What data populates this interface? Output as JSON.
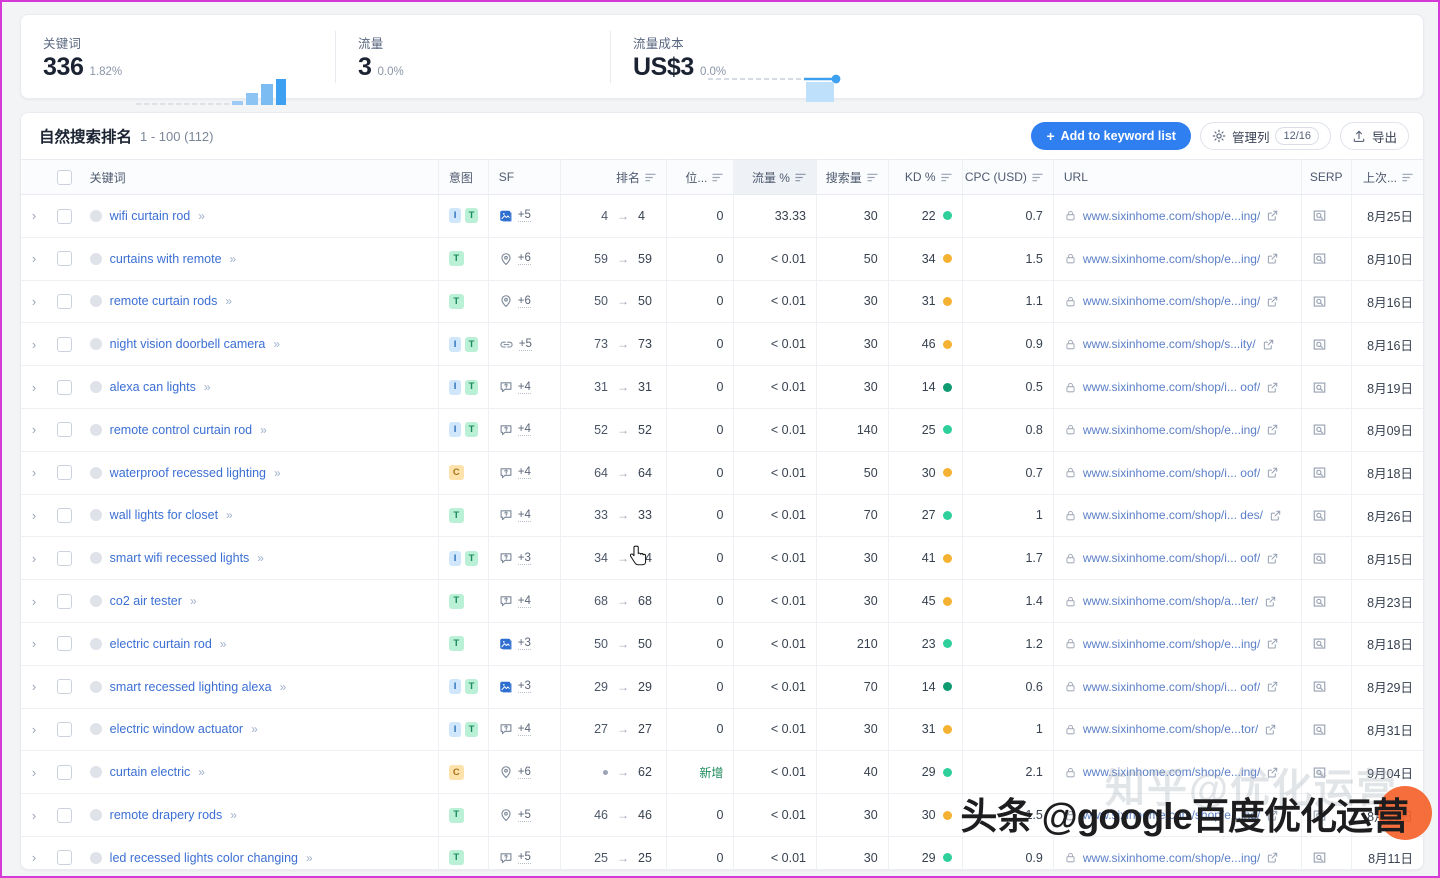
{
  "kpis": [
    {
      "title": "关键词",
      "value": "336",
      "delta": "1.82%",
      "spark": "bars"
    },
    {
      "title": "流量",
      "value": "3",
      "delta": "0.0%",
      "spark": "line-area"
    },
    {
      "title": "流量成本",
      "value": "US$3",
      "delta": "0.0%",
      "spark": "none"
    }
  ],
  "card": {
    "title": "自然搜索排名",
    "count": "1 - 100 (112)",
    "add_button": "Add to keyword list",
    "add_plus": "+",
    "manage_columns": "管理列",
    "manage_pill": "12/16",
    "export": "导出"
  },
  "columns": {
    "keyword": "关键词",
    "intent": "意图",
    "sf": "SF",
    "rank": "排名",
    "pos": "位...",
    "traffic": "流量 %",
    "volume": "搜索量",
    "kd": "KD %",
    "cpc": "CPC (USD)",
    "url": "URL",
    "serp": "SERP",
    "last": "上次..."
  },
  "colors": {
    "accent": "#2f7ff0",
    "kd_green_dark": "#0f9b72",
    "kd_green": "#2ecf9b",
    "kd_orange": "#f5b132",
    "badge_blue": "#cfe6fb",
    "badge_green": "#b9f0d6",
    "badge_orange": "#fde2ab",
    "watermark_blob": "#f4622a"
  },
  "rows": [
    {
      "keyword": "wifi curtain rod",
      "intent": [
        "I",
        "T"
      ],
      "sf_icon": "image-icon",
      "sf": "+5",
      "rank_from": "4",
      "rank_to": "4",
      "pos": "0",
      "traffic": "33.33",
      "volume": "30",
      "kd": "22",
      "kd_color": "#2ecf9b",
      "cpc": "0.7",
      "url": "www.sixinhome.com/shop/e...ing/",
      "last": "8月25日"
    },
    {
      "keyword": "curtains with remote",
      "intent": [
        "T"
      ],
      "sf_icon": "location-icon",
      "sf": "+6",
      "rank_from": "59",
      "rank_to": "59",
      "pos": "0",
      "traffic": "< 0.01",
      "volume": "50",
      "kd": "34",
      "kd_color": "#f5b132",
      "cpc": "1.5",
      "url": "www.sixinhome.com/shop/e...ing/",
      "last": "8月10日"
    },
    {
      "keyword": "remote curtain rods",
      "intent": [
        "T"
      ],
      "sf_icon": "location-icon",
      "sf": "+6",
      "rank_from": "50",
      "rank_to": "50",
      "pos": "0",
      "traffic": "< 0.01",
      "volume": "30",
      "kd": "31",
      "kd_color": "#f5b132",
      "cpc": "1.1",
      "url": "www.sixinhome.com/shop/e...ing/",
      "last": "8月16日"
    },
    {
      "keyword": "night vision doorbell camera",
      "intent": [
        "I",
        "T"
      ],
      "sf_icon": "link-icon",
      "sf": "+5",
      "rank_from": "73",
      "rank_to": "73",
      "pos": "0",
      "traffic": "< 0.01",
      "volume": "30",
      "kd": "46",
      "kd_color": "#f5b132",
      "cpc": "0.9",
      "url": "www.sixinhome.com/shop/s...ity/",
      "last": "8月16日"
    },
    {
      "keyword": "alexa can lights",
      "intent": [
        "I",
        "T"
      ],
      "sf_icon": "faq-icon",
      "sf": "+4",
      "rank_from": "31",
      "rank_to": "31",
      "pos": "0",
      "traffic": "< 0.01",
      "volume": "30",
      "kd": "14",
      "kd_color": "#0f9b72",
      "cpc": "0.5",
      "url": "www.sixinhome.com/shop/i... oof/",
      "last": "8月19日"
    },
    {
      "keyword": "remote control curtain rod",
      "intent": [
        "I",
        "T"
      ],
      "sf_icon": "faq-icon",
      "sf": "+4",
      "rank_from": "52",
      "rank_to": "52",
      "pos": "0",
      "traffic": "< 0.01",
      "volume": "140",
      "kd": "25",
      "kd_color": "#2ecf9b",
      "cpc": "0.8",
      "url": "www.sixinhome.com/shop/e...ing/",
      "last": "8月09日"
    },
    {
      "keyword": "waterproof recessed lighting",
      "intent": [
        "C"
      ],
      "sf_icon": "faq-icon",
      "sf": "+4",
      "rank_from": "64",
      "rank_to": "64",
      "pos": "0",
      "traffic": "< 0.01",
      "volume": "50",
      "kd": "30",
      "kd_color": "#f5b132",
      "cpc": "0.7",
      "url": "www.sixinhome.com/shop/i... oof/",
      "last": "8月18日"
    },
    {
      "keyword": "wall lights for closet",
      "intent": [
        "T"
      ],
      "sf_icon": "faq-icon",
      "sf": "+4",
      "rank_from": "33",
      "rank_to": "33",
      "pos": "0",
      "traffic": "< 0.01",
      "volume": "70",
      "kd": "27",
      "kd_color": "#2ecf9b",
      "cpc": "1",
      "url": "www.sixinhome.com/shop/i... des/",
      "last": "8月26日"
    },
    {
      "keyword": "smart wifi recessed lights",
      "intent": [
        "I",
        "T"
      ],
      "sf_icon": "faq-icon",
      "sf": "+3",
      "rank_from": "34",
      "rank_to": "34",
      "pos": "0",
      "traffic": "< 0.01",
      "volume": "30",
      "kd": "41",
      "kd_color": "#f5b132",
      "cpc": "1.7",
      "url": "www.sixinhome.com/shop/i... oof/",
      "last": "8月15日"
    },
    {
      "keyword": "co2 air tester",
      "intent": [
        "T"
      ],
      "sf_icon": "faq-icon",
      "sf": "+4",
      "rank_from": "68",
      "rank_to": "68",
      "pos": "0",
      "traffic": "< 0.01",
      "volume": "30",
      "kd": "45",
      "kd_color": "#f5b132",
      "cpc": "1.4",
      "url": "www.sixinhome.com/shop/a...ter/",
      "last": "8月23日"
    },
    {
      "keyword": "electric curtain rod",
      "intent": [
        "T"
      ],
      "sf_icon": "image-icon",
      "sf": "+3",
      "rank_from": "50",
      "rank_to": "50",
      "pos": "0",
      "traffic": "< 0.01",
      "volume": "210",
      "kd": "23",
      "kd_color": "#2ecf9b",
      "cpc": "1.2",
      "url": "www.sixinhome.com/shop/e...ing/",
      "last": "8月18日"
    },
    {
      "keyword": "smart recessed lighting alexa",
      "intent": [
        "I",
        "T"
      ],
      "sf_icon": "image-icon",
      "sf": "+3",
      "rank_from": "29",
      "rank_to": "29",
      "pos": "0",
      "traffic": "< 0.01",
      "volume": "70",
      "kd": "14",
      "kd_color": "#0f9b72",
      "cpc": "0.6",
      "url": "www.sixinhome.com/shop/i... oof/",
      "last": "8月29日"
    },
    {
      "keyword": "electric window actuator",
      "intent": [
        "I",
        "T"
      ],
      "sf_icon": "faq-icon",
      "sf": "+4",
      "rank_from": "27",
      "rank_to": "27",
      "pos": "0",
      "traffic": "< 0.01",
      "volume": "30",
      "kd": "31",
      "kd_color": "#f5b132",
      "cpc": "1",
      "url": "www.sixinhome.com/shop/e...tor/",
      "last": "8月31日"
    },
    {
      "keyword": "curtain electric",
      "intent": [
        "C"
      ],
      "sf_icon": "location-icon",
      "sf": "+6",
      "rank_from": "•",
      "rank_to": "62",
      "pos": "新增",
      "traffic": "< 0.01",
      "volume": "40",
      "kd": "29",
      "kd_color": "#2ecf9b",
      "cpc": "2.1",
      "url": "www.sixinhome.com/shop/e...ing/",
      "last": "9月04日"
    },
    {
      "keyword": "remote drapery rods",
      "intent": [
        "T"
      ],
      "sf_icon": "location-icon",
      "sf": "+5",
      "rank_from": "46",
      "rank_to": "46",
      "pos": "0",
      "traffic": "< 0.01",
      "volume": "30",
      "kd": "30",
      "kd_color": "#f5b132",
      "cpc": "1.5",
      "url": "www.sixinhome.com/shop/e...ing/",
      "last": "8月15日"
    },
    {
      "keyword": "led recessed lights color changing",
      "intent": [
        "T"
      ],
      "sf_icon": "faq-icon",
      "sf": "+5",
      "rank_from": "25",
      "rank_to": "25",
      "pos": "0",
      "traffic": "< 0.01",
      "volume": "30",
      "kd": "29",
      "kd_color": "#2ecf9b",
      "cpc": "0.9",
      "url": "www.sixinhome.com/shop/e...ing/",
      "last": "8月11日"
    }
  ],
  "watermark": {
    "text": "头条 @google百度优化运营",
    "ghost": "知乎@优化运营"
  }
}
